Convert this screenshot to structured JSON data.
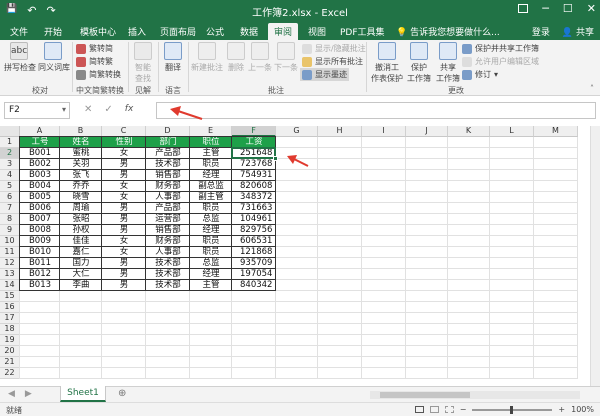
{
  "window": {
    "title": "工作簿2.xlsx - Excel",
    "restore_icon": "ribbon-display-icon",
    "minimize": "─",
    "maximize": "☐",
    "close": "✕"
  },
  "quick_access": {
    "save": "💾",
    "undo": "↶",
    "redo": "↷"
  },
  "tabs": [
    "文件",
    "开始",
    "模板中心",
    "插入",
    "页面布局",
    "公式",
    "数据",
    "审阅",
    "视图",
    "PDF工具集"
  ],
  "active_tab": "审阅",
  "tell_me": "告诉我您想要做什么...",
  "login": "登录",
  "share": "共享",
  "ribbon": {
    "spelling": "拼写检查",
    "thesaurus": "同义词库",
    "trad_to_simp": "繁转简",
    "simp_to_trad": "简转繁",
    "convert": "简繁转换",
    "smart_lookup_1": "智能",
    "smart_lookup_2": "查找",
    "translate": "翻译",
    "new_comment": "新建批注",
    "delete": "删除",
    "prev": "上一条",
    "next": "下一条",
    "show_hide_comment": "显示/隐藏批注",
    "show_all_comments": "显示所有批注",
    "show_ink": "显示墨迹",
    "unprotect_1": "撤消工",
    "unprotect_2": "作表保护",
    "protect_wb_1": "保护",
    "protect_wb_2": "工作簿",
    "share_wb_1": "共享",
    "share_wb_2": "工作簿",
    "protect_share": "保护并共享工作簿",
    "allow_edit": "允许用户编辑区域",
    "track_changes": "修订",
    "groups": {
      "proofing": "校对",
      "chinese": "中文简繁转换",
      "insights": "见解",
      "language": "语言",
      "comments": "批注",
      "changes": "更改"
    }
  },
  "formula_bar": {
    "name_box": "F2",
    "cancel": "✕",
    "enter": "✓",
    "fx": "fx",
    "value": ""
  },
  "columns": [
    "A",
    "B",
    "C",
    "D",
    "E",
    "F",
    "G",
    "H",
    "I",
    "J",
    "K",
    "L",
    "M"
  ],
  "rows": [
    "1",
    "2",
    "3",
    "4",
    "5",
    "6",
    "7",
    "8",
    "9",
    "10",
    "11",
    "12",
    "13",
    "14",
    "15",
    "16",
    "17",
    "18",
    "19",
    "20",
    "21",
    "22"
  ],
  "selected_cell": "F2",
  "table": {
    "headers": [
      "工号",
      "姓名",
      "性别",
      "部门",
      "职位",
      "工资"
    ],
    "rows": [
      [
        "B001",
        "蜜桃",
        "女",
        "产品部",
        "主管",
        "251648"
      ],
      [
        "B002",
        "关羽",
        "男",
        "技术部",
        "职员",
        "723768"
      ],
      [
        "B003",
        "张飞",
        "男",
        "销售部",
        "经理",
        "754931"
      ],
      [
        "B004",
        "乔乔",
        "女",
        "财务部",
        "副总监",
        "820608"
      ],
      [
        "B005",
        "晓雪",
        "女",
        "人事部",
        "副主管",
        "348372"
      ],
      [
        "B006",
        "周瑜",
        "男",
        "产品部",
        "职员",
        "731663"
      ],
      [
        "B007",
        "张昭",
        "男",
        "运营部",
        "总监",
        "104961"
      ],
      [
        "B008",
        "孙权",
        "男",
        "销售部",
        "经理",
        "829756"
      ],
      [
        "B009",
        "佳佳",
        "女",
        "财务部",
        "职员",
        "606531"
      ],
      [
        "B010",
        "嘉仁",
        "女",
        "人事部",
        "职员",
        "121868"
      ],
      [
        "B011",
        "国力",
        "男",
        "技术部",
        "总监",
        "935709"
      ],
      [
        "B012",
        "大仁",
        "男",
        "技术部",
        "经理",
        "197054"
      ],
      [
        "B013",
        "李曲",
        "男",
        "技术部",
        "主管",
        "840342"
      ]
    ]
  },
  "sheet_tab": "Sheet1",
  "add_sheet": "⊕",
  "status": {
    "ready": "就绪",
    "zoom": "100%",
    "zoom_minus": "−",
    "zoom_plus": "+"
  },
  "colors": {
    "brand": "#217346",
    "header_fill": "#1ea049",
    "arrow": "#e03a2e"
  }
}
